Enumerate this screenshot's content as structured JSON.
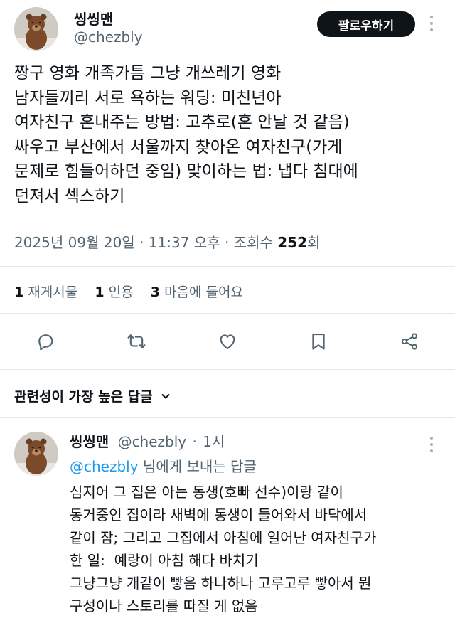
{
  "post": {
    "author": {
      "display_name": "씽씽맨",
      "handle": "@chezbly"
    },
    "follow_label": "팔로우하기",
    "text_lines": [
      "짱구 영화 개족가틈 그냥 개쓰레기 영화",
      "남자들끼리 서로 욕하는 워딩: 미친년아",
      "여자친구 혼내주는 방법: 고추로(혼 안날 것 같음)",
      "싸우고 부산에서 서울까지 찾아온 여자친구(가게",
      "문제로 힘들어하던 중임) 맞이하는 법: 냅다 침대에",
      "던져서 섹스하기"
    ],
    "meta": {
      "date": "2025년 09월 20일",
      "time": "11:37 오후",
      "views_label": "조회수",
      "views_count": "252",
      "views_suffix": "회",
      "separator": "·"
    },
    "stats": {
      "reposts_count": "1",
      "reposts_label": "재게시물",
      "quotes_count": "1",
      "quotes_label": "인용",
      "likes_count": "3",
      "likes_label": "마음에 들어요"
    },
    "actions": [
      "reply-icon",
      "repost-icon",
      "like-icon",
      "bookmark-icon",
      "share-icon"
    ]
  },
  "replies_sort_label": "관련성이 가장 높은 답글",
  "reply": {
    "display_name": "씽씽맨",
    "handle": "@chezbly",
    "time_ago": "1시",
    "separator": "·",
    "replying_to_mention": "@chezbly",
    "replying_to_suffix": "님에게 보내는 답글",
    "text_lines": [
      "심지어 그 집은 아는 동생(호빠 선수)이랑 같이",
      "동거중인 집이라 새벽에 동생이 들어와서 바닥에서",
      "같이 잠; 그리고 그집에서 아침에 일어난 여자친구가",
      "한 일:  예랑이 아침 해다 바치기",
      "그냥그냥 개같이 빻음 하나하나 고루고루 빻아서 뭔",
      "구성이나 스토리를 따질 게 없음"
    ]
  },
  "colors": {
    "text": "#0f1419",
    "secondary": "#536471",
    "accent": "#1d9bf0",
    "button_bg": "#0f1419",
    "divider": "#e4e8eb"
  }
}
